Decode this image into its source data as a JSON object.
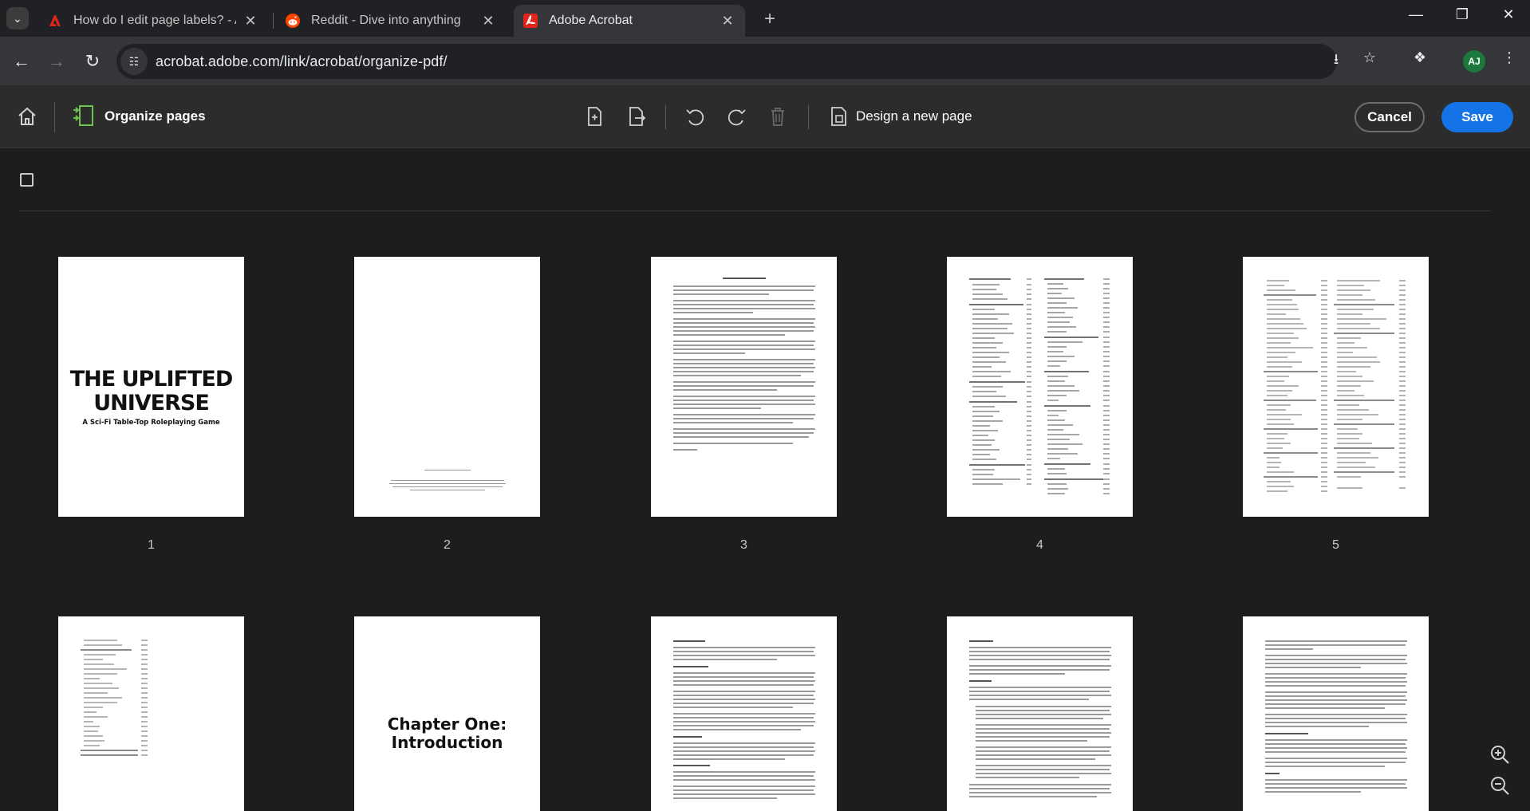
{
  "browser": {
    "tabs": [
      {
        "title": "How do I edit page labels? - Ad",
        "active": false
      },
      {
        "title": "Reddit - Dive into anything",
        "active": false
      },
      {
        "title": "Adobe Acrobat",
        "active": true
      }
    ],
    "url": "acrobat.adobe.com/link/acrobat/organize-pdf/",
    "profile_initials": "AJ"
  },
  "toolbar": {
    "title": "Organize pages",
    "design_new_page": "Design a new page",
    "cancel": "Cancel",
    "save": "Save"
  },
  "pages": {
    "cover_title_line1": "THE UPLIFTED",
    "cover_title_line2": "UNIVERSE",
    "cover_subtitle": "A Sci-Fi Table-Top Roleplaying Game",
    "chapter_title_line1": "Chapter One:",
    "chapter_title_line2": "Introduction",
    "numbers": [
      "1",
      "2",
      "3",
      "4",
      "5"
    ]
  },
  "colors": {
    "accent": "#1473e6",
    "toolbar_bg": "#2c2c2c",
    "content_bg": "#1d1d1d",
    "adobe_red": "#e1251b",
    "reddit_orange": "#ff4500"
  }
}
